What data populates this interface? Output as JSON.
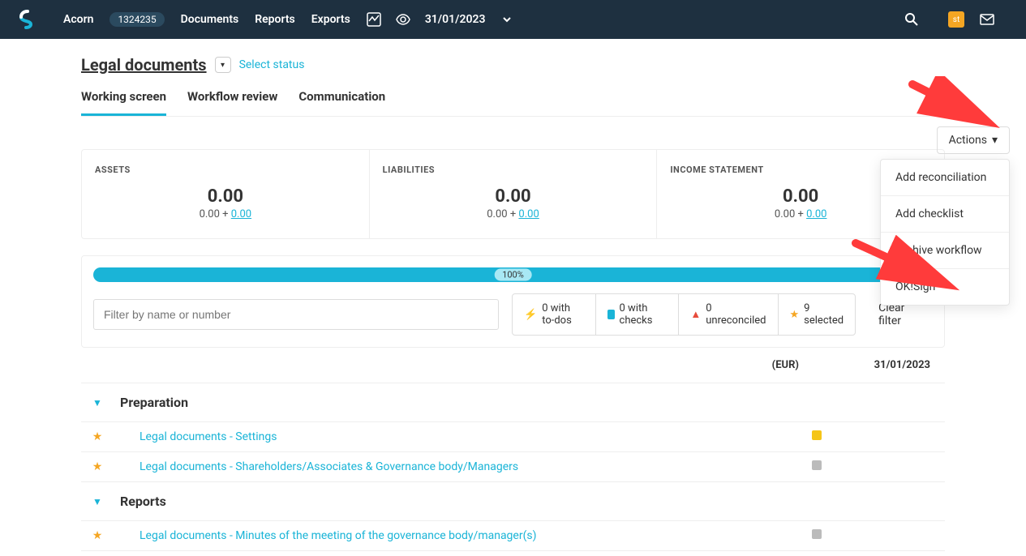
{
  "navbar": {
    "company": "Acorn",
    "id": "1324235",
    "items": [
      "Documents",
      "Reports",
      "Exports"
    ],
    "date": "31/01/2023"
  },
  "page": {
    "title": "Legal documents",
    "select_status": "Select status"
  },
  "tabs": {
    "t0": "Working screen",
    "t1": "Workflow review",
    "t2": "Communication"
  },
  "actions": {
    "label": "Actions",
    "menu": {
      "m0": "Add reconciliation",
      "m1": "Add checklist",
      "m2": "Archive workflow",
      "m3": "OK!Sign"
    }
  },
  "summary": {
    "c0": {
      "label": "ASSETS",
      "value": "0.00",
      "sub_a": "0.00",
      "sub_b": "0.00"
    },
    "c1": {
      "label": "LIABILITIES",
      "value": "0.00",
      "sub_a": "0.00",
      "sub_b": "0.00"
    },
    "c2": {
      "label": "INCOME STATEMENT",
      "value": "0.00",
      "sub_a": "0.00",
      "sub_b": "0.00"
    }
  },
  "progress": {
    "pct": "100%"
  },
  "filter": {
    "placeholder": "Filter by name or number",
    "todos": "0 with to-dos",
    "checks": "0 with checks",
    "unreconciled": "0 unreconciled",
    "selected": "9 selected",
    "clear": "Clear filter"
  },
  "table": {
    "currency": "(EUR)",
    "date_col": "31/01/2023",
    "sections": {
      "s0": "Preparation",
      "s1": "Reports"
    },
    "rows": {
      "r0": "Legal documents - Settings",
      "r1": "Legal documents - Shareholders/Associates & Governance body/Managers",
      "r2": "Legal documents - Minutes of the meeting of the governance body/manager(s)"
    }
  },
  "user_badge": "st"
}
